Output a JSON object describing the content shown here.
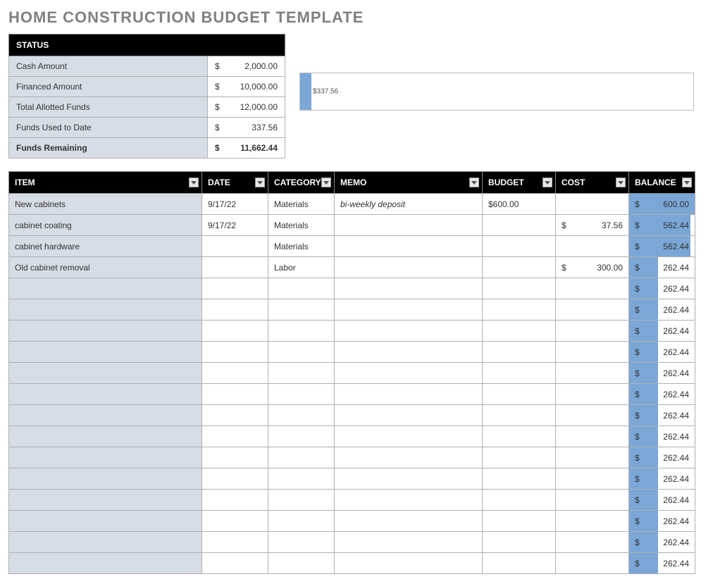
{
  "title": "HOME CONSTRUCTION BUDGET TEMPLATE",
  "status": {
    "header": "STATUS",
    "rows": [
      {
        "label": "Cash Amount",
        "value": "2,000.00",
        "bold": false
      },
      {
        "label": "Financed Amount",
        "value": "10,000.00",
        "bold": false
      },
      {
        "label": "Total Allotted Funds",
        "value": "12,000.00",
        "bold": false
      },
      {
        "label": "Funds Used to Date",
        "value": "337.56",
        "bold": false
      },
      {
        "label": "Funds Remaining",
        "value": "11,662.44",
        "bold": true
      }
    ]
  },
  "chart": {
    "label": "$337.56",
    "used": 337.56,
    "total": 12000,
    "bar_width_pct": 2.8
  },
  "columns": {
    "item": "ITEM",
    "date": "DATE",
    "category": "CATEGORY",
    "memo": "MEMO",
    "budget": "BUDGET",
    "cost": "COST",
    "balance": "BALANCE"
  },
  "rows": [
    {
      "item": "New cabinets",
      "date": "9/17/22",
      "category": "Materials",
      "memo": "bi-weekly deposit",
      "memo_italic": true,
      "budget": "$600.00",
      "cost": "",
      "balance": "600.00",
      "bar_pct": 100
    },
    {
      "item": "cabinet coating",
      "date": "9/17/22",
      "category": "Materials",
      "memo": "",
      "budget": "",
      "cost": "37.56",
      "balance": "562.44",
      "bar_pct": 94
    },
    {
      "item": "cabinet hardware",
      "date": "",
      "category": "Materials",
      "memo": "",
      "budget": "",
      "cost": "",
      "balance": "562.44",
      "bar_pct": 94
    },
    {
      "item": "Old cabinet removal",
      "date": "",
      "category": "Labor",
      "memo": "",
      "budget": "",
      "cost": "300.00",
      "balance": "262.44",
      "bar_pct": 44
    },
    {
      "item": "",
      "date": "",
      "category": "",
      "memo": "",
      "budget": "",
      "cost": "",
      "balance": "262.44",
      "bar_pct": 44
    },
    {
      "item": "",
      "date": "",
      "category": "",
      "memo": "",
      "budget": "",
      "cost": "",
      "balance": "262.44",
      "bar_pct": 44
    },
    {
      "item": "",
      "date": "",
      "category": "",
      "memo": "",
      "budget": "",
      "cost": "",
      "balance": "262.44",
      "bar_pct": 44
    },
    {
      "item": "",
      "date": "",
      "category": "",
      "memo": "",
      "budget": "",
      "cost": "",
      "balance": "262.44",
      "bar_pct": 44
    },
    {
      "item": "",
      "date": "",
      "category": "",
      "memo": "",
      "budget": "",
      "cost": "",
      "balance": "262.44",
      "bar_pct": 44
    },
    {
      "item": "",
      "date": "",
      "category": "",
      "memo": "",
      "budget": "",
      "cost": "",
      "balance": "262.44",
      "bar_pct": 44
    },
    {
      "item": "",
      "date": "",
      "category": "",
      "memo": "",
      "budget": "",
      "cost": "",
      "balance": "262.44",
      "bar_pct": 44
    },
    {
      "item": "",
      "date": "",
      "category": "",
      "memo": "",
      "budget": "",
      "cost": "",
      "balance": "262.44",
      "bar_pct": 44
    },
    {
      "item": "",
      "date": "",
      "category": "",
      "memo": "",
      "budget": "",
      "cost": "",
      "balance": "262.44",
      "bar_pct": 44
    },
    {
      "item": "",
      "date": "",
      "category": "",
      "memo": "",
      "budget": "",
      "cost": "",
      "balance": "262.44",
      "bar_pct": 44
    },
    {
      "item": "",
      "date": "",
      "category": "",
      "memo": "",
      "budget": "",
      "cost": "",
      "balance": "262.44",
      "bar_pct": 44
    },
    {
      "item": "",
      "date": "",
      "category": "",
      "memo": "",
      "budget": "",
      "cost": "",
      "balance": "262.44",
      "bar_pct": 44
    },
    {
      "item": "",
      "date": "",
      "category": "",
      "memo": "",
      "budget": "",
      "cost": "",
      "balance": "262.44",
      "bar_pct": 44
    },
    {
      "item": "",
      "date": "",
      "category": "",
      "memo": "",
      "budget": "",
      "cost": "",
      "balance": "262.44",
      "bar_pct": 44
    }
  ]
}
